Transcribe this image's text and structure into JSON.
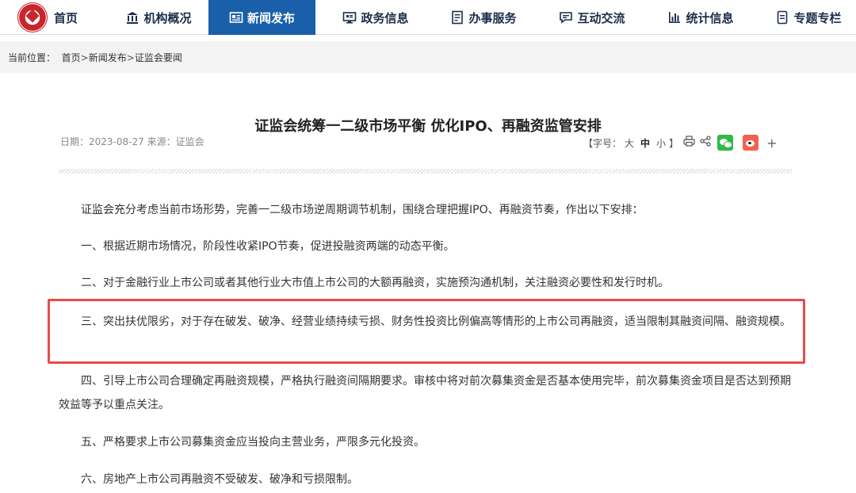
{
  "nav": {
    "items": [
      {
        "label": "首页",
        "icon": "home-logo"
      },
      {
        "label": "机构概况",
        "icon": "building-icon"
      },
      {
        "label": "新闻发布",
        "icon": "news-icon",
        "active": true
      },
      {
        "label": "政务信息",
        "icon": "monitor-icon"
      },
      {
        "label": "办事服务",
        "icon": "document-icon"
      },
      {
        "label": "互动交流",
        "icon": "chat-icon"
      },
      {
        "label": "统计信息",
        "icon": "bar-chart-icon"
      },
      {
        "label": "专题专栏",
        "icon": "page-icon"
      }
    ],
    "active_color": "#1a5fa9"
  },
  "breadcrumb": {
    "prefix": "当前位置：",
    "items": [
      "首页",
      "新闻发布",
      "证监会要闻"
    ],
    "separator": ">"
  },
  "article": {
    "title": "证监会统筹一二级市场平衡 优化IPO、再融资监管安排",
    "date_label": "日期：",
    "date": "2023-08-27",
    "source_label": "来源：",
    "source": "证监会",
    "font_size_label_open": "【字号：",
    "font_sizes": [
      "大",
      "中",
      "小"
    ],
    "font_size_label_close": "】",
    "paragraphs": [
      "证监会充分考虑当前市场形势，完善一二级市场逆周期调节机制，围绕合理把握IPO、再融资节奏，作出以下安排：",
      "一、根据近期市场情况，阶段性收紧IPO节奏，促进投融资两端的动态平衡。",
      "二、对于金融行业上市公司或者其他行业大市值上市公司的大额再融资，实施预沟通机制，关注融资必要性和发行时机。",
      "三、突出扶优限劣，对于存在破发、破净、经营业绩持续亏损、财务性投资比例偏高等情形的上市公司再融资，适当限制其融资间隔、融资规模。",
      "四、引导上市公司合理确定再融资规模，严格执行融资间隔期要求。审核中将对前次募集资金是否基本使用完毕，前次募集资金项目是否达到预期效益等予以重点关注。",
      "五、严格要求上市公司募集资金应当投向主营业务，严限多元化投资。",
      "六、房地产上市公司再融资不受破发、破净和亏损限制。"
    ],
    "highlight_color": "#e84b4b"
  }
}
